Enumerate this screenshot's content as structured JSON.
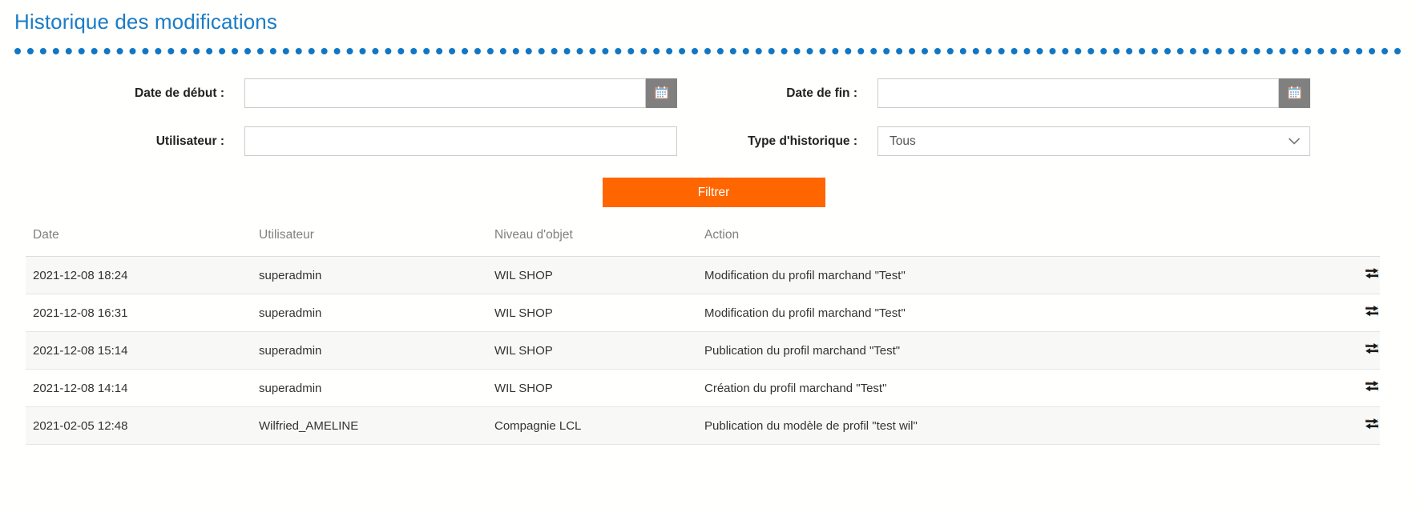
{
  "page": {
    "title": "Historique des modifications",
    "accent_blue": "#1a7cc7",
    "accent_orange": "#ff6600"
  },
  "filters": {
    "date_debut": {
      "label": "Date de début :",
      "value": "",
      "placeholder": "",
      "calendar_icon": "calendar-icon"
    },
    "date_fin": {
      "label": "Date de fin :",
      "value": "",
      "placeholder": "",
      "calendar_icon": "calendar-icon"
    },
    "utilisateur": {
      "label": "Utilisateur :",
      "value": "",
      "placeholder": ""
    },
    "type_historique": {
      "label": "Type d'historique :",
      "selected": "Tous",
      "options": [
        "Tous"
      ],
      "chevron_icon": "chevron-down-icon"
    },
    "submit_label": "Filtrer"
  },
  "table": {
    "columns": [
      "Date",
      "Utilisateur",
      "Niveau d'objet",
      "Action",
      ""
    ],
    "row_action_icon": "exchange-arrows-icon",
    "rows": [
      {
        "date": "2021-12-08 18:24",
        "utilisateur": "superadmin",
        "niveau": "WIL SHOP",
        "action": "Modification du profil marchand \"Test\""
      },
      {
        "date": "2021-12-08 16:31",
        "utilisateur": "superadmin",
        "niveau": "WIL SHOP",
        "action": "Modification du profil marchand \"Test\""
      },
      {
        "date": "2021-12-08 15:14",
        "utilisateur": "superadmin",
        "niveau": "WIL SHOP",
        "action": "Publication du profil marchand \"Test\""
      },
      {
        "date": "2021-12-08 14:14",
        "utilisateur": "superadmin",
        "niveau": "WIL SHOP",
        "action": "Création du profil marchand \"Test\""
      },
      {
        "date": "2021-02-05 12:48",
        "utilisateur": "Wilfried_AMELINE",
        "niveau": "Compagnie LCL",
        "action": "Publication du modèle de profil \"test wil\""
      }
    ]
  }
}
